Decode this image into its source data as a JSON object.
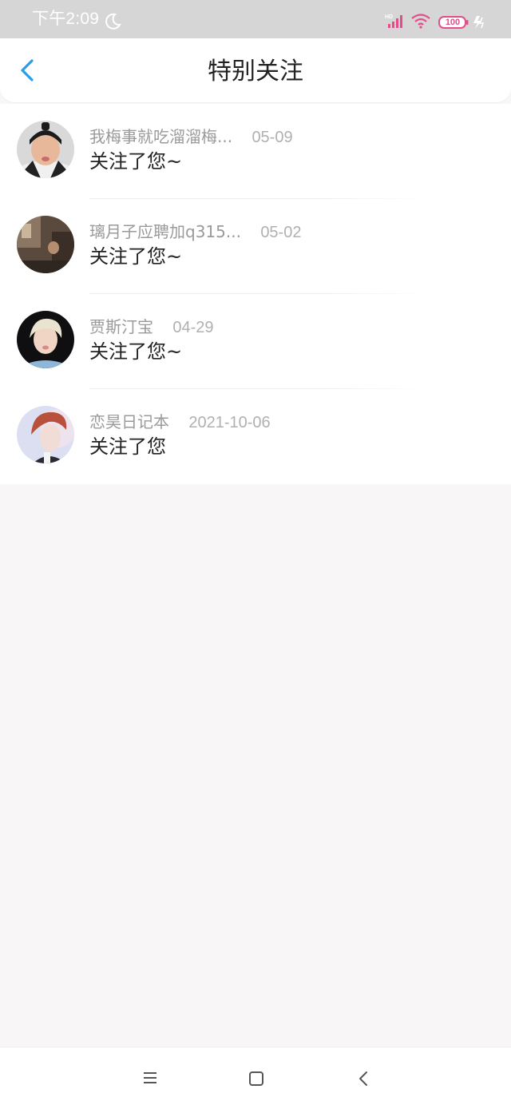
{
  "status_bar": {
    "time": "下午2:09",
    "battery": "100",
    "icons": [
      "moon-icon",
      "hd-signal-icon",
      "wifi-icon",
      "battery-icon",
      "charging-icon"
    ],
    "accent_color": "#e24d8a"
  },
  "header": {
    "title": "特别关注",
    "back_icon": "chevron-left-icon",
    "accent_color": "#2a9ee8"
  },
  "items": [
    {
      "name": "我梅事就吃溜溜梅...",
      "date": "05-09",
      "message": "关注了您~"
    },
    {
      "name": "璃月子应聘加q315...",
      "date": "05-02",
      "message": "关注了您~"
    },
    {
      "name": "贾斯汀宝",
      "date": "04-29",
      "message": "关注了您~"
    },
    {
      "name": "恋昊日记本",
      "date": "2021-10-06",
      "message": "关注了您"
    }
  ],
  "nav": {
    "icons": [
      "menu-icon",
      "home-icon",
      "back-icon"
    ]
  }
}
